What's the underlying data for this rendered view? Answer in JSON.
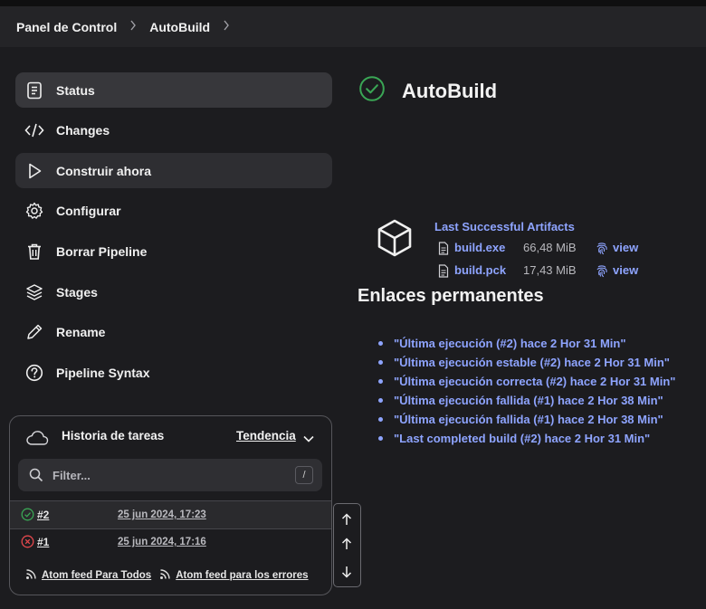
{
  "breadcrumb": {
    "items": [
      "Panel de Control",
      "AutoBuild"
    ]
  },
  "sidebar": {
    "items": [
      {
        "label": "Status",
        "icon": "document-icon"
      },
      {
        "label": "Changes",
        "icon": "code-icon"
      },
      {
        "label": "Construir ahora",
        "icon": "play-icon"
      },
      {
        "label": "Configurar",
        "icon": "gear-icon"
      },
      {
        "label": "Borrar Pipeline",
        "icon": "trash-icon"
      },
      {
        "label": "Stages",
        "icon": "layers-icon"
      },
      {
        "label": "Rename",
        "icon": "pencil-icon"
      },
      {
        "label": "Pipeline Syntax",
        "icon": "help-icon"
      }
    ]
  },
  "history": {
    "title": "Historia de tareas",
    "trend_label": "Tendencia",
    "filter_placeholder": "Filter...",
    "filter_shortcut": "/",
    "builds": [
      {
        "number": "#2",
        "date": "25 jun 2024, 17:23",
        "status": "success"
      },
      {
        "number": "#1",
        "date": "25 jun 2024, 17:16",
        "status": "failed"
      }
    ],
    "feed_all": "Atom feed Para Todos",
    "feed_errors": "Atom feed para los errores"
  },
  "main": {
    "title": "AutoBuild",
    "artifacts": {
      "heading": "Last Successful Artifacts",
      "files": [
        {
          "name": "build.exe",
          "size": "66,48 MiB",
          "view": "view"
        },
        {
          "name": "build.pck",
          "size": "17,43 MiB",
          "view": "view"
        }
      ]
    },
    "permalinks": {
      "heading": "Enlaces permanentes",
      "links": [
        "\"Última ejecución (#2) hace 2 Hor 31 Min\"",
        "\"Última ejecución estable (#2) hace 2 Hor 31 Min\"",
        "\"Última ejecución correcta (#2) hace 2 Hor 31 Min\"",
        "\"Última ejecución fallida (#1) hace 2 Hor 38 Min\"",
        "\"Última ejecución fallida (#1) hace 2 Hor 38 Min\"",
        "\"Last completed build (#2) hace 2 Hor 31 Min\""
      ]
    }
  },
  "colors": {
    "background": "#1c1c1f",
    "link": "#8ea4ff",
    "success": "#3aa655",
    "failure": "#e5484d"
  }
}
